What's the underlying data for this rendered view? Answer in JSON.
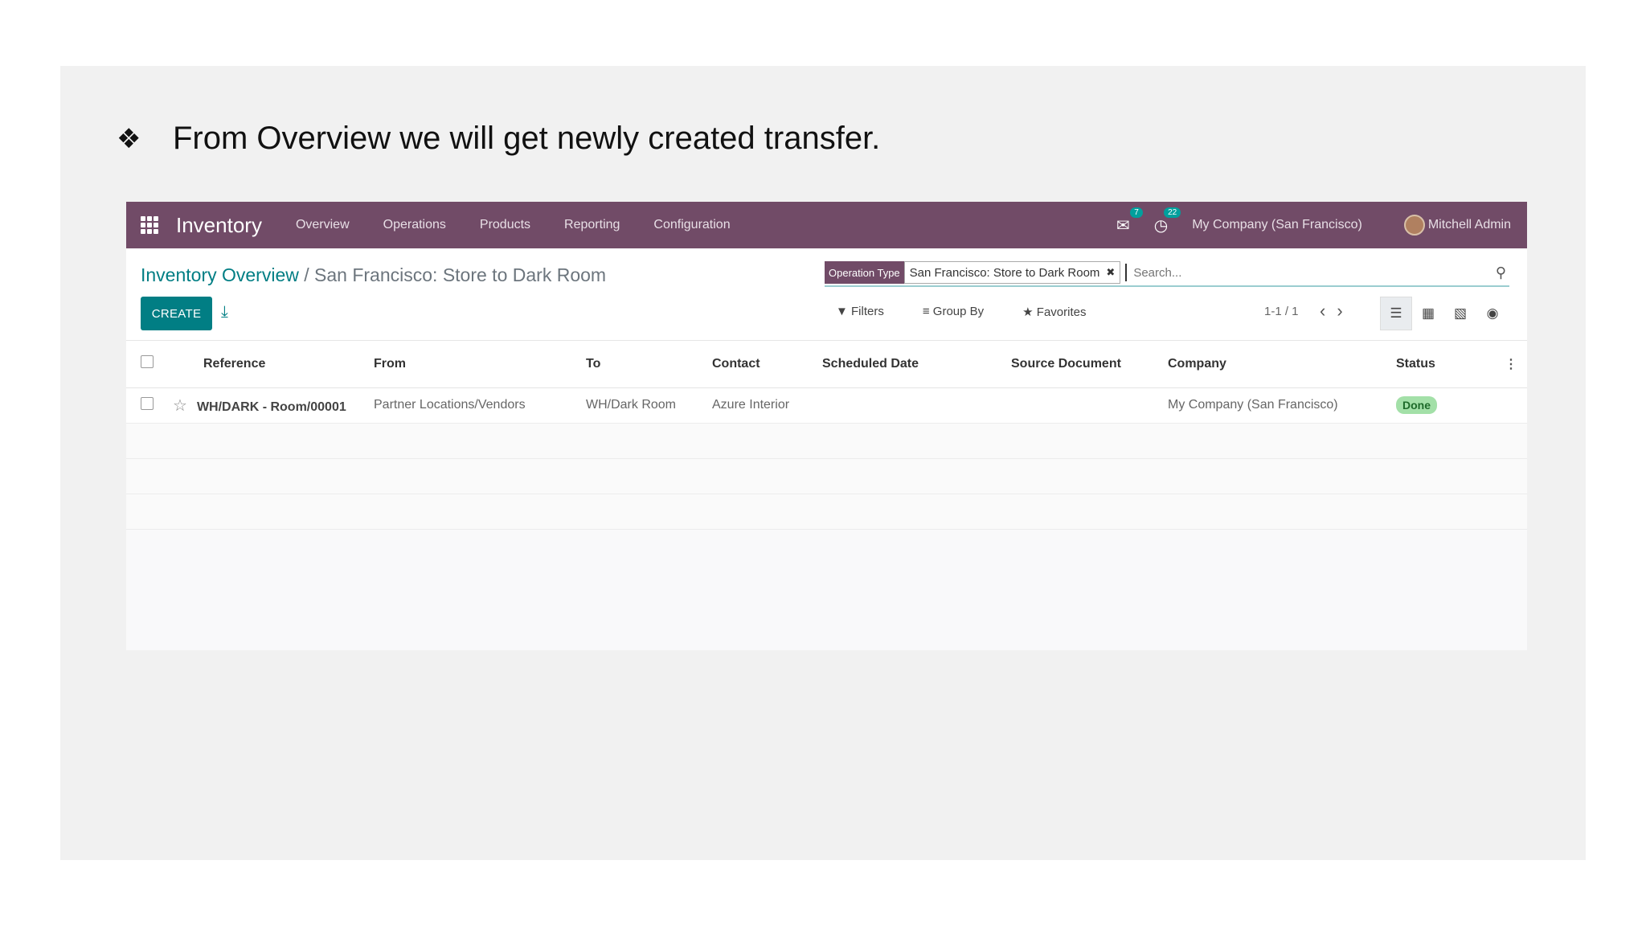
{
  "slide": {
    "bullet_glyph": "❖",
    "bullet_text": "From Overview we will get newly created transfer."
  },
  "navbar": {
    "app_name": "Inventory",
    "menu": [
      "Overview",
      "Operations",
      "Products",
      "Reporting",
      "Configuration"
    ],
    "messages_badge": "7",
    "activities_badge": "22",
    "company": "My Company (San Francisco)",
    "user": "Mitchell Admin"
  },
  "breadcrumb": {
    "parent": "Inventory Overview",
    "separator": " / ",
    "current": "San Francisco: Store to Dark Room"
  },
  "toolbar": {
    "create_label": "CREATE",
    "filters_label": "Filters",
    "group_by_label": "Group By",
    "favorites_label": "Favorites",
    "pager": "1-1 / 1"
  },
  "search": {
    "facet_label": "Operation Type",
    "facet_value": "San Francisco: Store to Dark Room",
    "placeholder": "Search..."
  },
  "table": {
    "columns": [
      "Reference",
      "From",
      "To",
      "Contact",
      "Scheduled Date",
      "Source Document",
      "Company",
      "Status"
    ],
    "rows": [
      {
        "reference": "WH/DARK - Room/00001",
        "from": "Partner Locations/Vendors",
        "to": "WH/Dark Room",
        "contact": "Azure Interior",
        "scheduled_date": "",
        "source_document": "",
        "company": "My Company (San Francisco)",
        "status": "Done"
      }
    ]
  },
  "colors": {
    "navbar": "#714b67",
    "accent": "#017e84",
    "done_badge": "#a3e0a8"
  }
}
